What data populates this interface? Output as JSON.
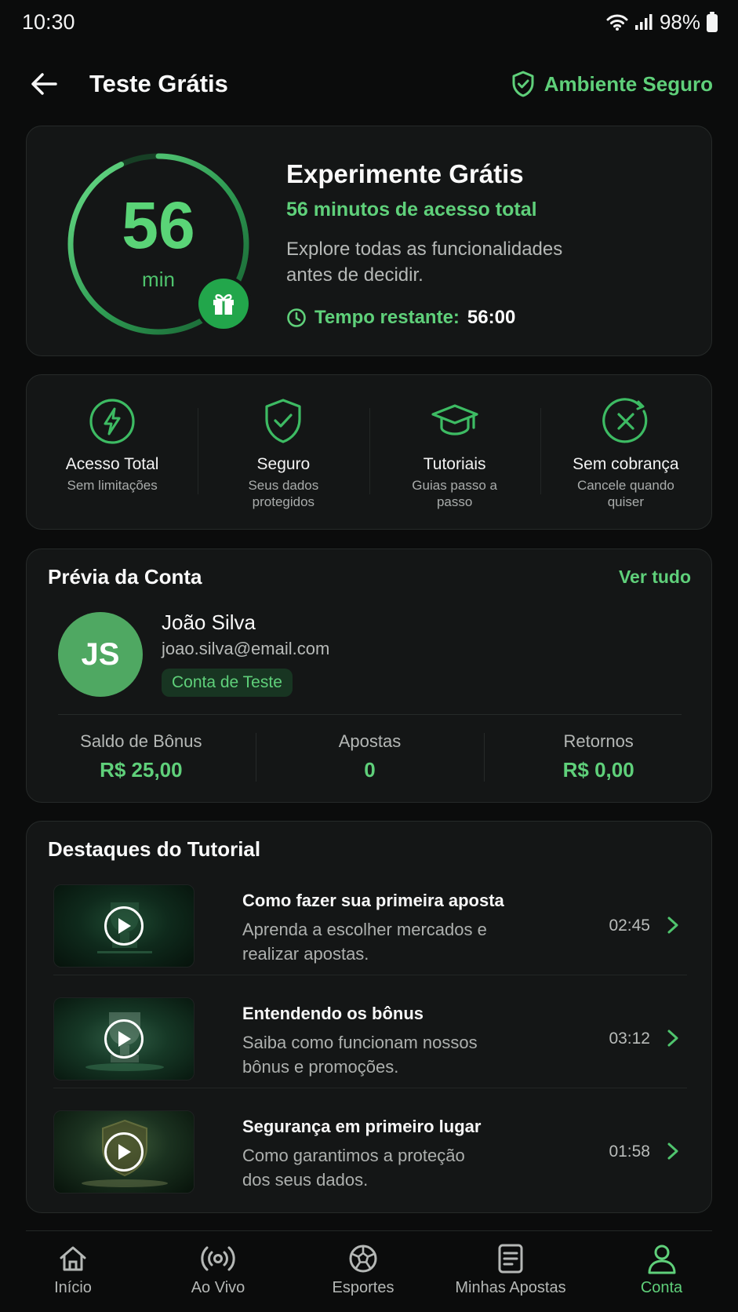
{
  "status": {
    "time": "10:30",
    "battery": "98%"
  },
  "header": {
    "title": "Teste Grátis",
    "secure_label": "Ambiente Seguro"
  },
  "hero": {
    "ring_value": "56",
    "ring_unit": "min",
    "ring_progress": 0.93,
    "title": "Experimente Grátis",
    "subtitle": "56 minutos de acesso total",
    "description": "Explore todas as funcionalidades antes de decidir.",
    "timer_label": "Tempo restante:",
    "timer_value": "56:00"
  },
  "features": [
    {
      "icon": "lightning-icon",
      "title": "Acesso Total",
      "desc": "Sem limitações"
    },
    {
      "icon": "shield-check-icon",
      "title": "Seguro",
      "desc": "Seus dados protegidos"
    },
    {
      "icon": "graduation-cap-icon",
      "title": "Tutoriais",
      "desc": "Guias passo a passo"
    },
    {
      "icon": "cancel-icon",
      "title": "Sem cobrança",
      "desc": "Cancele quando quiser"
    }
  ],
  "account": {
    "title": "Prévia da Conta",
    "link": "Ver tudo",
    "initials": "JS",
    "name": "João Silva",
    "email": "joao.silva@email.com",
    "tag": "Conta de Teste",
    "stats": [
      {
        "label": "Saldo de Bônus",
        "value": "R$ 25,00"
      },
      {
        "label": "Apostas",
        "value": "0"
      },
      {
        "label": "Retornos",
        "value": "R$ 0,00"
      }
    ]
  },
  "tutorials": {
    "title": "Destaques do Tutorial",
    "items": [
      {
        "name": "Como fazer sua primeira aposta",
        "desc": "Aprenda a escolher mercados e realizar apostas.",
        "duration": "02:45"
      },
      {
        "name": "Entendendo os bônus",
        "desc": "Saiba como funcionam nossos bônus e promoções.",
        "duration": "03:12"
      },
      {
        "name": "Segurança em primeiro lugar",
        "desc": "Como garantimos a proteção dos seus dados.",
        "duration": "01:58"
      }
    ]
  },
  "nav": [
    {
      "label": "Início",
      "icon": "home-icon"
    },
    {
      "label": "Ao Vivo",
      "icon": "live-icon"
    },
    {
      "label": "Esportes",
      "icon": "soccer-ball-icon"
    },
    {
      "label": "Minhas Apostas",
      "icon": "bets-document-icon"
    },
    {
      "label": "Conta",
      "icon": "user-icon",
      "active": true
    }
  ],
  "colors": {
    "accent": "#5fd07a",
    "background": "#0b0c0c",
    "card": "#141616",
    "gift": "#22a64b"
  }
}
